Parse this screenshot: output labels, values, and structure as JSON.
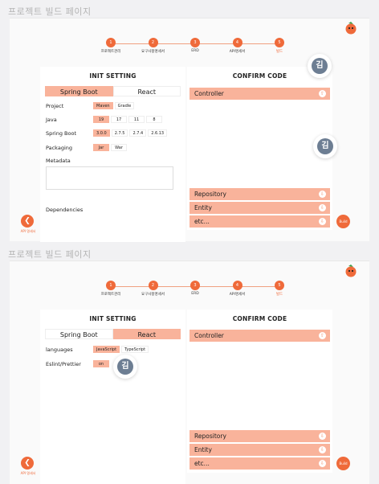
{
  "page_title": "프로젝트 빌드 페이지",
  "steps": [
    {
      "num": "1",
      "label": "프로젝트관리"
    },
    {
      "num": "2",
      "label": "요구사항명세서"
    },
    {
      "num": "3",
      "label": "ERD"
    },
    {
      "num": "4",
      "label": "API명세서"
    },
    {
      "num": "5",
      "label": "빌드"
    }
  ],
  "init_title": "INIT SETTING",
  "confirm_title": "CONFIRM CODE",
  "tabs": {
    "spring": "Spring Boot",
    "react": "React"
  },
  "spring": {
    "project": {
      "label": "Project",
      "options": [
        "Maven",
        "Gradle"
      ],
      "selected": 0
    },
    "java": {
      "label": "Java",
      "options": [
        "19",
        "17",
        "11",
        "8"
      ],
      "selected": 0
    },
    "boot": {
      "label": "Spring Boot",
      "options": [
        "3.0.0",
        "2.7.5",
        "2.7.4",
        "2.6.13"
      ],
      "selected": 0
    },
    "packaging": {
      "label": "Packaging",
      "options": [
        "Jar",
        "War"
      ],
      "selected": 0
    },
    "metadata_label": "Metadata",
    "dependencies_label": "Dependencies"
  },
  "react": {
    "languages": {
      "label": "languages",
      "options": [
        "JavaScript",
        "TypeScript"
      ],
      "selected": 0
    },
    "eslint": {
      "label": "Eslint/Prettier",
      "options": [
        "on"
      ],
      "selected": 0
    }
  },
  "accordion": {
    "controller": "Controller",
    "repository": "Repository",
    "entity": "Entity",
    "etc": "etc..."
  },
  "avatar_char": "김",
  "back_label": "API 명세서",
  "build_label": "Build",
  "colors": {
    "accent": "#ef6a3a",
    "accent_light": "#f9b39b"
  }
}
